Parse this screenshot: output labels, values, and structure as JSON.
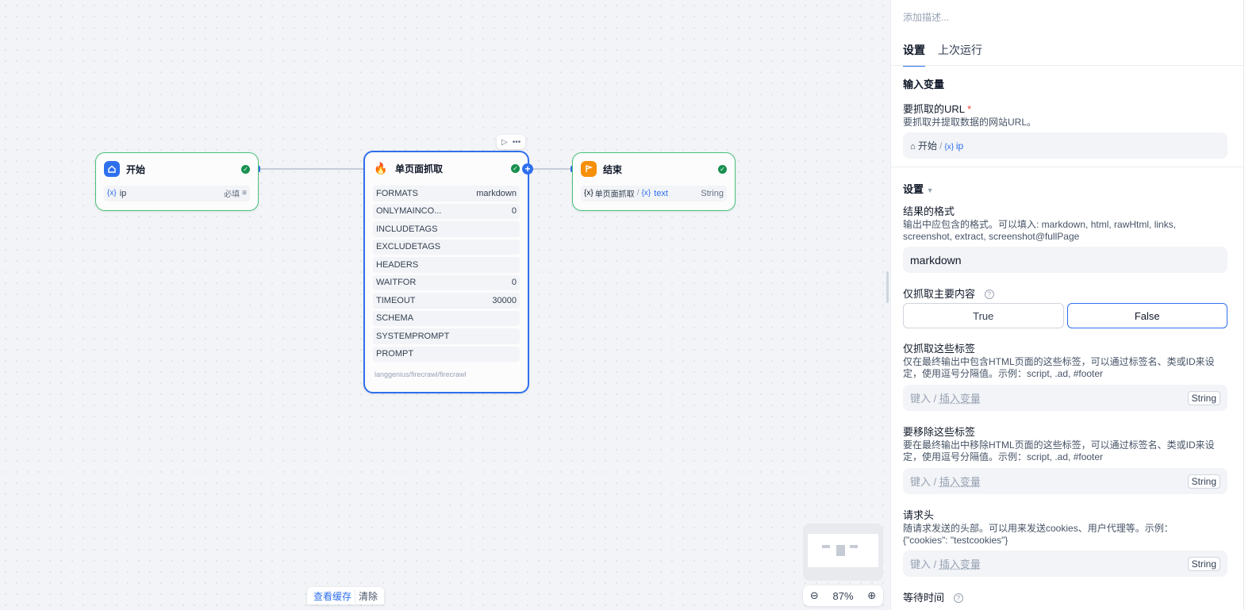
{
  "canvas": {
    "start_node": {
      "title": "开始",
      "var_name": "ip",
      "required_label": "必填"
    },
    "firecrawl_node": {
      "title": "单页面抓取",
      "rows": [
        {
          "key": "FORMATS",
          "value": "markdown"
        },
        {
          "key": "ONLYMAINCO...",
          "value": "0"
        },
        {
          "key": "INCLUDETAGS",
          "value": ""
        },
        {
          "key": "EXCLUDETAGS",
          "value": ""
        },
        {
          "key": "HEADERS",
          "value": ""
        },
        {
          "key": "WAITFOR",
          "value": "0"
        },
        {
          "key": "TIMEOUT",
          "value": "30000"
        },
        {
          "key": "SCHEMA",
          "value": ""
        },
        {
          "key": "SYSTEMPROMPT",
          "value": ""
        },
        {
          "key": "PROMPT",
          "value": ""
        }
      ],
      "footer": "langgenius/firecrawl/firecrawl"
    },
    "end_node": {
      "title": "结束",
      "source_node": "单页面抓取",
      "var_name": "text",
      "type": "String"
    },
    "bottom_buttons": {
      "view_cache": "查看缓存",
      "clear": "清除"
    },
    "zoom": "87%"
  },
  "panel": {
    "description_placeholder": "添加描述...",
    "tabs": [
      {
        "label": "设置",
        "active": true
      },
      {
        "label": "上次运行",
        "active": false
      }
    ],
    "input_vars_title": "输入变量",
    "url_field": {
      "label": "要抓取的URL",
      "required_mark": "*",
      "help": "要抓取并提取数据的网站URL。",
      "node": "开始",
      "sep": "/",
      "var": "ip"
    },
    "settings_title": "设置",
    "formats_field": {
      "label": "结果的格式",
      "help": "输出中应包含的格式。可以填入: markdown, html, rawHtml, links, screenshot, extract, screenshot@fullPage",
      "value": "markdown"
    },
    "only_main_field": {
      "label": "仅抓取主要内容",
      "options": [
        "True",
        "False"
      ],
      "selected": "False"
    },
    "include_tags_field": {
      "label": "仅抓取这些标签",
      "help": "仅在最终输出中包含HTML页面的这些标签，可以通过标签名、类或ID来设定，使用逗号分隔值。示例：script, .ad, #footer",
      "placeholder_type": "键入",
      "placeholder_sep": "/",
      "placeholder_insert": "插入变量",
      "type": "String"
    },
    "exclude_tags_field": {
      "label": "要移除这些标签",
      "help": "要在最终输出中移除HTML页面的这些标签，可以通过标签名、类或ID来设定，使用逗号分隔值。示例：script, .ad, #footer",
      "placeholder_type": "键入",
      "placeholder_sep": "/",
      "placeholder_insert": "插入变量",
      "type": "String"
    },
    "headers_field": {
      "label": "请求头",
      "help": "随请求发送的头部。可以用来发送cookies、用户代理等。示例：{\"cookies\": \"testcookies\"}",
      "placeholder_type": "键入",
      "placeholder_sep": "/",
      "placeholder_insert": "插入变量",
      "type": "String"
    },
    "wait_field": {
      "label": "等待时间"
    }
  },
  "colors": {
    "accent": "#2f6fed",
    "success": "#17904d",
    "node_border": "#47c27a",
    "end_icon": "#f79009"
  }
}
